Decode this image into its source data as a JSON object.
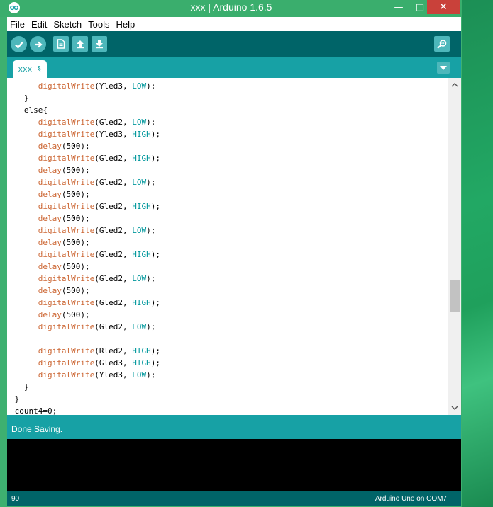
{
  "window": {
    "title": "xxx | Arduino 1.6.5",
    "min": "—",
    "max": "□",
    "close": "✕"
  },
  "menu": [
    "File",
    "Edit",
    "Sketch",
    "Tools",
    "Help"
  ],
  "toolbar": {
    "buttons": [
      "verify-icon",
      "upload-icon",
      "new-icon",
      "open-icon",
      "save-icon",
      "serial-monitor-icon"
    ]
  },
  "tabs": {
    "active": "xxx §"
  },
  "editor": {
    "lines": [
      [
        {
          "t": "      "
        },
        {
          "t": "digitalWrite",
          "c": "fn"
        },
        {
          "t": "(Yled3, "
        },
        {
          "t": "LOW",
          "c": "kw"
        },
        {
          "t": ");"
        }
      ],
      [
        {
          "t": "   }"
        }
      ],
      [
        {
          "t": "   else{"
        }
      ],
      [
        {
          "t": "      "
        },
        {
          "t": "digitalWrite",
          "c": "fn"
        },
        {
          "t": "(Gled2, "
        },
        {
          "t": "LOW",
          "c": "kw"
        },
        {
          "t": ");"
        }
      ],
      [
        {
          "t": "      "
        },
        {
          "t": "digitalWrite",
          "c": "fn"
        },
        {
          "t": "(Yled3, "
        },
        {
          "t": "HIGH",
          "c": "kw"
        },
        {
          "t": ");"
        }
      ],
      [
        {
          "t": "      "
        },
        {
          "t": "delay",
          "c": "fn"
        },
        {
          "t": "(500);"
        }
      ],
      [
        {
          "t": "      "
        },
        {
          "t": "digitalWrite",
          "c": "fn"
        },
        {
          "t": "(Gled2, "
        },
        {
          "t": "HIGH",
          "c": "kw"
        },
        {
          "t": ");"
        }
      ],
      [
        {
          "t": "      "
        },
        {
          "t": "delay",
          "c": "fn"
        },
        {
          "t": "(500);"
        }
      ],
      [
        {
          "t": "      "
        },
        {
          "t": "digitalWrite",
          "c": "fn"
        },
        {
          "t": "(Gled2, "
        },
        {
          "t": "LOW",
          "c": "kw"
        },
        {
          "t": ");"
        }
      ],
      [
        {
          "t": "      "
        },
        {
          "t": "delay",
          "c": "fn"
        },
        {
          "t": "(500);"
        }
      ],
      [
        {
          "t": "      "
        },
        {
          "t": "digitalWrite",
          "c": "fn"
        },
        {
          "t": "(Gled2, "
        },
        {
          "t": "HIGH",
          "c": "kw"
        },
        {
          "t": ");"
        }
      ],
      [
        {
          "t": "      "
        },
        {
          "t": "delay",
          "c": "fn"
        },
        {
          "t": "(500);"
        }
      ],
      [
        {
          "t": "      "
        },
        {
          "t": "digitalWrite",
          "c": "fn"
        },
        {
          "t": "(Gled2, "
        },
        {
          "t": "LOW",
          "c": "kw"
        },
        {
          "t": ");"
        }
      ],
      [
        {
          "t": "      "
        },
        {
          "t": "delay",
          "c": "fn"
        },
        {
          "t": "(500);"
        }
      ],
      [
        {
          "t": "      "
        },
        {
          "t": "digitalWrite",
          "c": "fn"
        },
        {
          "t": "(Gled2, "
        },
        {
          "t": "HIGH",
          "c": "kw"
        },
        {
          "t": ");"
        }
      ],
      [
        {
          "t": "      "
        },
        {
          "t": "delay",
          "c": "fn"
        },
        {
          "t": "(500);"
        }
      ],
      [
        {
          "t": "      "
        },
        {
          "t": "digitalWrite",
          "c": "fn"
        },
        {
          "t": "(Gled2, "
        },
        {
          "t": "LOW",
          "c": "kw"
        },
        {
          "t": ");"
        }
      ],
      [
        {
          "t": "      "
        },
        {
          "t": "delay",
          "c": "fn"
        },
        {
          "t": "(500);"
        }
      ],
      [
        {
          "t": "      "
        },
        {
          "t": "digitalWrite",
          "c": "fn"
        },
        {
          "t": "(Gled2, "
        },
        {
          "t": "HIGH",
          "c": "kw"
        },
        {
          "t": ");"
        }
      ],
      [
        {
          "t": "      "
        },
        {
          "t": "delay",
          "c": "fn"
        },
        {
          "t": "(500);"
        }
      ],
      [
        {
          "t": "      "
        },
        {
          "t": "digitalWrite",
          "c": "fn"
        },
        {
          "t": "(Gled2, "
        },
        {
          "t": "LOW",
          "c": "kw"
        },
        {
          "t": ");"
        }
      ],
      [
        {
          "t": ""
        }
      ],
      [
        {
          "t": "      "
        },
        {
          "t": "digitalWrite",
          "c": "fn"
        },
        {
          "t": "(Rled2, "
        },
        {
          "t": "HIGH",
          "c": "kw"
        },
        {
          "t": ");"
        }
      ],
      [
        {
          "t": "      "
        },
        {
          "t": "digitalWrite",
          "c": "fn"
        },
        {
          "t": "(Gled3, "
        },
        {
          "t": "HIGH",
          "c": "kw"
        },
        {
          "t": ");"
        }
      ],
      [
        {
          "t": "      "
        },
        {
          "t": "digitalWrite",
          "c": "fn"
        },
        {
          "t": "(Yled3, "
        },
        {
          "t": "LOW",
          "c": "kw"
        },
        {
          "t": ");"
        }
      ],
      [
        {
          "t": "   }"
        }
      ],
      [
        {
          "t": " }"
        }
      ],
      [
        {
          "t": " count4=0;"
        }
      ]
    ]
  },
  "status": {
    "message": "Done Saving."
  },
  "footer": {
    "line": "90",
    "board": "Arduino Uno on COM7"
  },
  "colors": {
    "teal_dark": "#006468",
    "teal": "#17a1a5",
    "function": "#cc6633",
    "constant": "#00979c"
  }
}
